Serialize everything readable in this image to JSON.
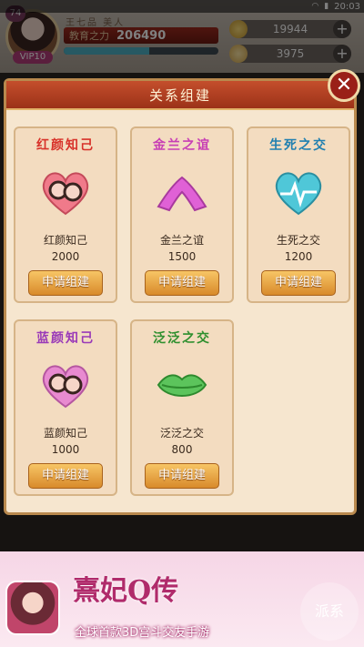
{
  "status_bar": {
    "time": "20:03"
  },
  "hud": {
    "level": "74",
    "vip": "VIP10",
    "name_text": "王七品 美人",
    "power_label": "教育之力",
    "power_value": "206490",
    "xp_progress": 0.55,
    "currencies": [
      {
        "value": "19944",
        "icon": "silver-ingot-icon"
      },
      {
        "value": "3975",
        "icon": "gold-ingot-icon"
      }
    ]
  },
  "dialog": {
    "title": "关系组建",
    "close_label": "✕",
    "cards": [
      {
        "title": "红颜知己",
        "name": "红颜知己",
        "cost": "2000",
        "button": "申请组建",
        "title_color": "#d8322a",
        "emblem": "couple-heart-icon"
      },
      {
        "title": "金兰之谊",
        "name": "金兰之谊",
        "cost": "1500",
        "button": "申请组建",
        "title_color": "#c83fb5",
        "emblem": "holding-hands-icon"
      },
      {
        "title": "生死之交",
        "name": "生死之交",
        "cost": "1200",
        "button": "申请组建",
        "title_color": "#1f7fb0",
        "emblem": "heartbeat-heart-icon"
      },
      {
        "title": "蓝颜知己",
        "name": "蓝颜知己",
        "cost": "1000",
        "button": "申请组建",
        "title_color": "#9a3ab8",
        "emblem": "couple-heart-pink-icon"
      },
      {
        "title": "泛泛之交",
        "name": "泛泛之交",
        "cost": "800",
        "button": "申请组建",
        "title_color": "#2e8f2e",
        "emblem": "lips-icon"
      }
    ]
  },
  "ad": {
    "logo": "熹妃Q传",
    "tagline": "全球首款3D宫斗交友手游",
    "side_label": "派系"
  }
}
